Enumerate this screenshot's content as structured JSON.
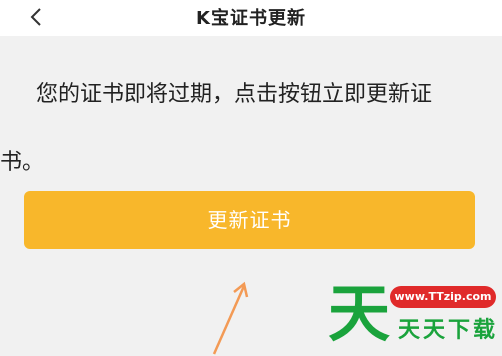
{
  "header": {
    "title": "K宝证书更新",
    "back_icon": "chevron-left-icon"
  },
  "main": {
    "message_line1": "您的证书即将过期，点击按钮立即更新证",
    "message_line2": "书。",
    "update_button_label": "更新证书"
  },
  "watermark": {
    "logo_char": "天",
    "url": "www.TTzip.com",
    "name": "天天下载"
  },
  "colors": {
    "button": "#f8b72b",
    "arrow": "#f39a55",
    "watermark_green": "#1aa33c",
    "watermark_red": "#e02a2a"
  }
}
